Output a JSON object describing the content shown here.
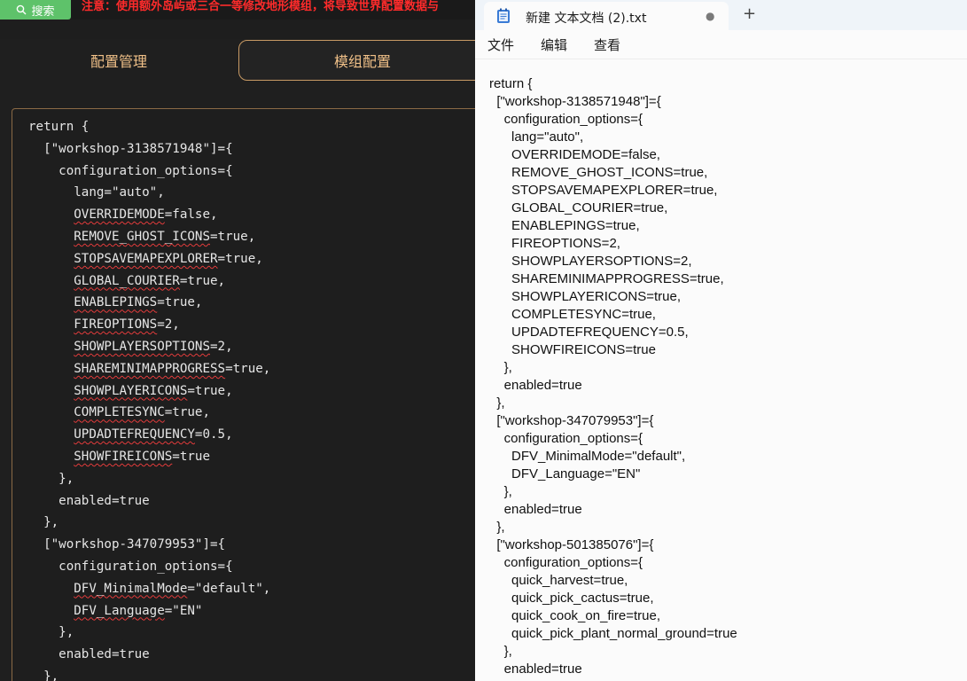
{
  "left_app": {
    "search_label": "搜索",
    "warning": "注意：使用额外岛屿或三合一等修改地形模组，将导致世界配置数据与",
    "tabs": [
      "配置管理",
      "模组配置"
    ],
    "code_lines": [
      "return {",
      "  [\"workshop-3138571948\"]={",
      "    configuration_options={",
      "      lang=\"auto\",",
      "      OVERRIDEMODE=false,",
      "      REMOVE_GHOST_ICONS=true,",
      "      STOPSAVEMAPEXPLORER=true,",
      "      GLOBAL_COURIER=true,",
      "      ENABLEPINGS=true,",
      "      FIREOPTIONS=2,",
      "      SHOWPLAYERSOPTIONS=2,",
      "      SHAREMINIMAPPROGRESS=true,",
      "      SHOWPLAYERICONS=true,",
      "      COMPLETESYNC=true,",
      "      UPDADTEFREQUENCY=0.5,",
      "      SHOWFIREICONS=true",
      "    },",
      "    enabled=true",
      "  },",
      "  [\"workshop-347079953\"]={",
      "    configuration_options={",
      "      DFV_MinimalMode=\"default\",",
      "      DFV_Language=\"EN\"",
      "    },",
      "    enabled=true",
      "  },"
    ]
  },
  "notepad": {
    "tab_title": "新建 文本文档 (2).txt",
    "menu": [
      "文件",
      "编辑",
      "查看"
    ],
    "code_lines": [
      "return {",
      "  [\"workshop-3138571948\"]={",
      "    configuration_options={",
      "      lang=\"auto\",",
      "      OVERRIDEMODE=false,",
      "      REMOVE_GHOST_ICONS=true,",
      "      STOPSAVEMAPEXPLORER=true,",
      "      GLOBAL_COURIER=true,",
      "      ENABLEPINGS=true,",
      "      FIREOPTIONS=2,",
      "      SHOWPLAYERSOPTIONS=2,",
      "      SHAREMINIMAPPROGRESS=true,",
      "      SHOWPLAYERICONS=true,",
      "      COMPLETESYNC=true,",
      "      UPDADTEFREQUENCY=0.5,",
      "      SHOWFIREICONS=true",
      "    },",
      "    enabled=true",
      "  },",
      "  [\"workshop-347079953\"]={",
      "    configuration_options={",
      "      DFV_MinimalMode=\"default\",",
      "      DFV_Language=\"EN\"",
      "    },",
      "    enabled=true",
      "  },",
      "  [\"workshop-501385076\"]={",
      "    configuration_options={",
      "      quick_harvest=true,",
      "      quick_pick_cactus=true,",
      "      quick_cook_on_fire=true,",
      "      quick_pick_plant_normal_ground=true",
      "    },",
      "    enabled=true"
    ]
  },
  "colors": {
    "search_green": "#5ec26a",
    "warning_red": "#ff2b2b",
    "tab_text_orange": "#f0c088",
    "squiggle_red": "#e23b3b"
  },
  "icons": {
    "search": "search-icon",
    "notepad": "notepad-icon",
    "tab_close": "close-dot-icon",
    "new_tab": "plus-icon"
  }
}
